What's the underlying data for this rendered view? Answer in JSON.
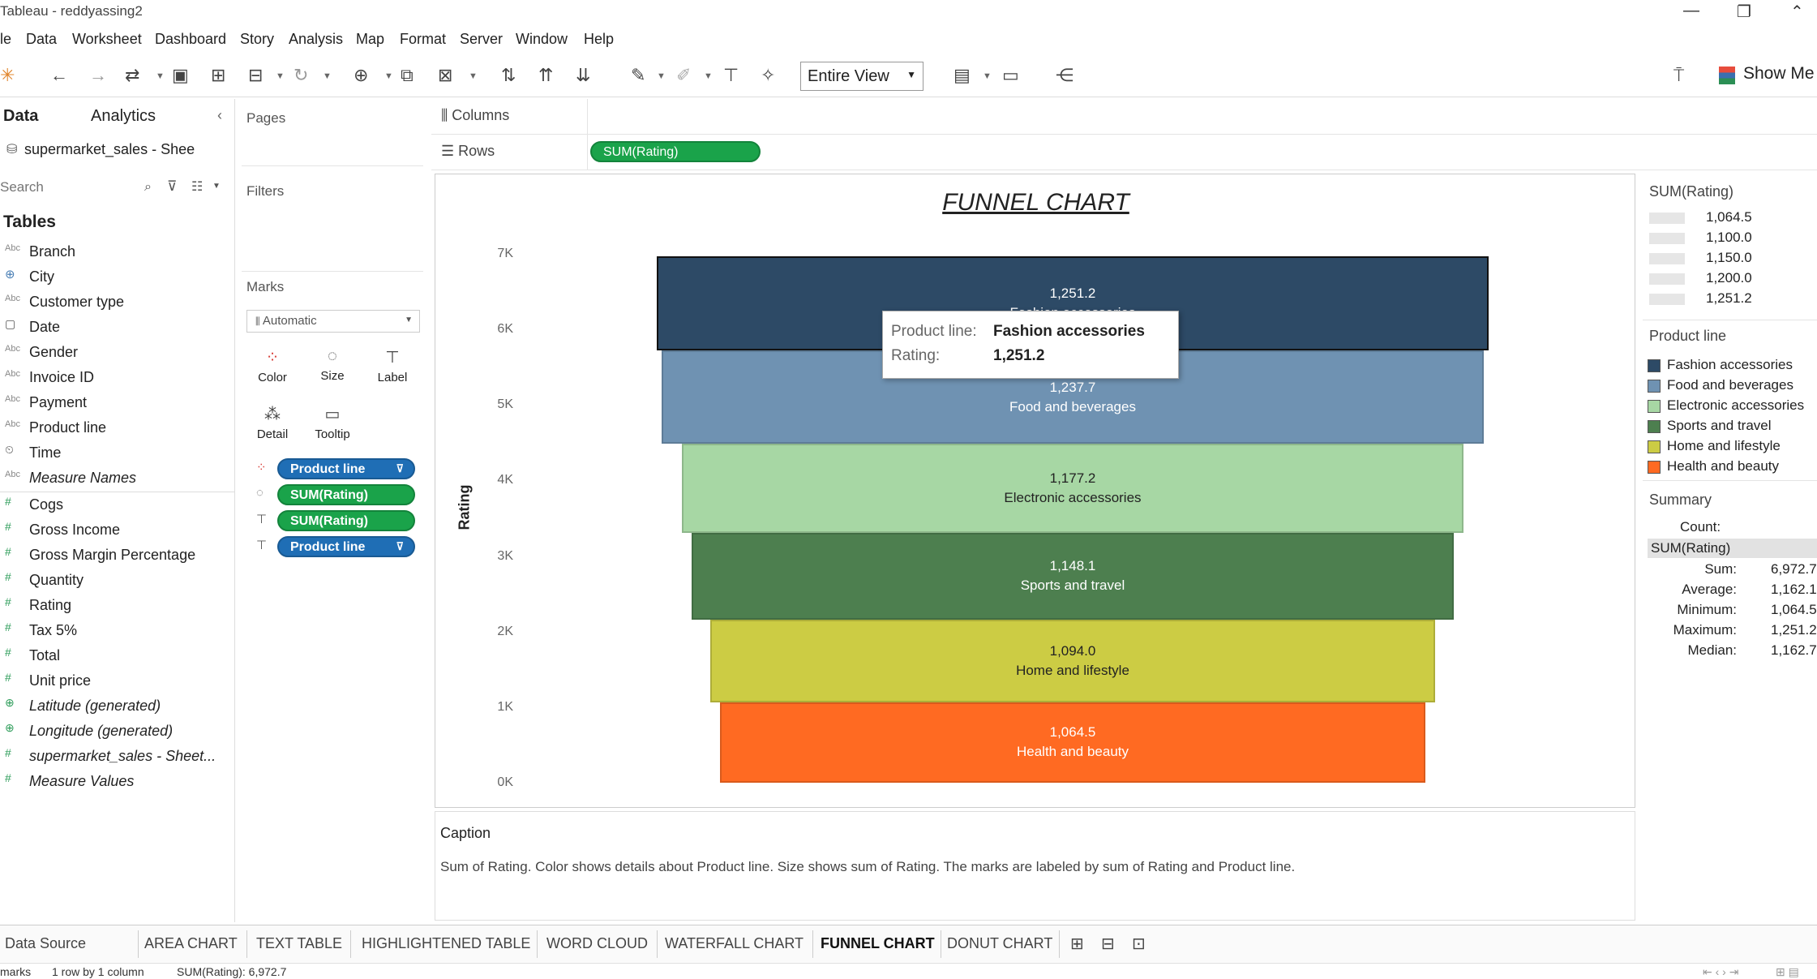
{
  "window": {
    "title": "Tableau - reddyassing2",
    "controls": [
      "—",
      "❐",
      "⌃"
    ]
  },
  "menu": [
    "le",
    "Data",
    "Worksheet",
    "Dashboard",
    "Story",
    "Analysis",
    "Map",
    "Format",
    "Server",
    "Window",
    "Help"
  ],
  "toolbar": {
    "view_select": "Entire View",
    "show_me": "Show Me"
  },
  "left_pane": {
    "tab_data": "Data",
    "tab_analytics": "Analytics",
    "datasource": "supermarket_sales - Shee",
    "search_placeholder": "Search",
    "tables_heading": "Tables",
    "dimensions": [
      {
        "icon": "Abc",
        "label": "Branch"
      },
      {
        "icon": "⊕",
        "label": "City"
      },
      {
        "icon": "Abc",
        "label": "Customer type"
      },
      {
        "icon": "▢",
        "label": "Date"
      },
      {
        "icon": "Abc",
        "label": "Gender"
      },
      {
        "icon": "Abc",
        "label": "Invoice ID"
      },
      {
        "icon": "Abc",
        "label": "Payment"
      },
      {
        "icon": "Abc",
        "label": "Product line"
      },
      {
        "icon": "⏲",
        "label": "Time"
      },
      {
        "icon": "Abc",
        "label": "Measure Names"
      }
    ],
    "measures": [
      {
        "icon": "#",
        "label": "Cogs"
      },
      {
        "icon": "#",
        "label": "Gross Income"
      },
      {
        "icon": "#",
        "label": "Gross Margin Percentage"
      },
      {
        "icon": "#",
        "label": "Quantity"
      },
      {
        "icon": "#",
        "label": "Rating"
      },
      {
        "icon": "#",
        "label": "Tax 5%"
      },
      {
        "icon": "#",
        "label": "Total"
      },
      {
        "icon": "#",
        "label": "Unit price"
      },
      {
        "icon": "⊕",
        "label": "Latitude (generated)"
      },
      {
        "icon": "⊕",
        "label": "Longitude (generated)"
      },
      {
        "icon": "#",
        "label": "supermarket_sales - Sheet..."
      },
      {
        "icon": "#",
        "label": "Measure Values"
      }
    ]
  },
  "cards": {
    "pages": "Pages",
    "filters": "Filters",
    "marks": "Marks",
    "mark_type": "Automatic",
    "buttons": [
      "Color",
      "Size",
      "Label",
      "Detail",
      "Tooltip"
    ],
    "pills": [
      "Product line",
      "SUM(Rating)",
      "SUM(Rating)",
      "Product line"
    ]
  },
  "shelves": {
    "columns_label": "Columns",
    "rows_label": "Rows",
    "rows_pill": "SUM(Rating)"
  },
  "chart_data": {
    "type": "bar",
    "title": "FUNNEL CHART",
    "ylabel": "Rating",
    "y_ticks": [
      "7K",
      "6K",
      "5K",
      "4K",
      "3K",
      "2K",
      "1K",
      "0K"
    ],
    "ylim": [
      0,
      7000
    ],
    "stacked": true,
    "categories": [
      "Fashion accessories",
      "Food and beverages",
      "Electronic accessories",
      "Sports and travel",
      "Home and lifestyle",
      "Health and beauty"
    ],
    "values": [
      1251.2,
      1237.7,
      1177.2,
      1148.1,
      1094.0,
      1064.5
    ],
    "value_labels": [
      "1,251.2",
      "1,237.7",
      "1,177.2",
      "1,148.1",
      "1,094.0",
      "1,064.5"
    ],
    "colors": [
      "#2d4a66",
      "#6f92b2",
      "#a7d7a4",
      "#4d7f4f",
      "#cccc44",
      "#ff6a22"
    ]
  },
  "tooltip": {
    "k1": "Product line:",
    "v1": "Fashion accessories",
    "k2": "Rating:",
    "v2": "1,251.2"
  },
  "legends": {
    "size_title": "SUM(Rating)",
    "size_items": [
      "1,064.5",
      "1,100.0",
      "1,150.0",
      "1,200.0",
      "1,251.2"
    ],
    "color_title": "Product line",
    "color_items": [
      "Fashion accessories",
      "Food and beverages",
      "Electronic accessories",
      "Sports and travel",
      "Home and lifestyle",
      "Health and beauty"
    ],
    "summary_title": "Summary",
    "summary_count_label": "Count:",
    "summary_measure": "SUM(Rating)",
    "summary_rows": [
      {
        "k": "Sum:",
        "v": "6,972.7"
      },
      {
        "k": "Average:",
        "v": "1,162.1"
      },
      {
        "k": "Minimum:",
        "v": "1,064.5"
      },
      {
        "k": "Maximum:",
        "v": "1,251.2"
      },
      {
        "k": "Median:",
        "v": "1,162.7"
      }
    ]
  },
  "caption": {
    "title": "Caption",
    "text": "Sum of Rating.  Color shows details about Product line.  Size shows sum of Rating.  The marks are labeled by sum of Rating and Product line."
  },
  "tabs": [
    "Data Source",
    "AREA CHART",
    "TEXT TABLE",
    "HIGHLIGHTENED TABLE",
    "WORD CLOUD",
    "WATERFALL CHART",
    "FUNNEL CHART",
    "DONUT CHART"
  ],
  "status": {
    "marks": "marks",
    "rows": "1 row by 1 column",
    "sum": "SUM(Rating): 6,972.7"
  }
}
